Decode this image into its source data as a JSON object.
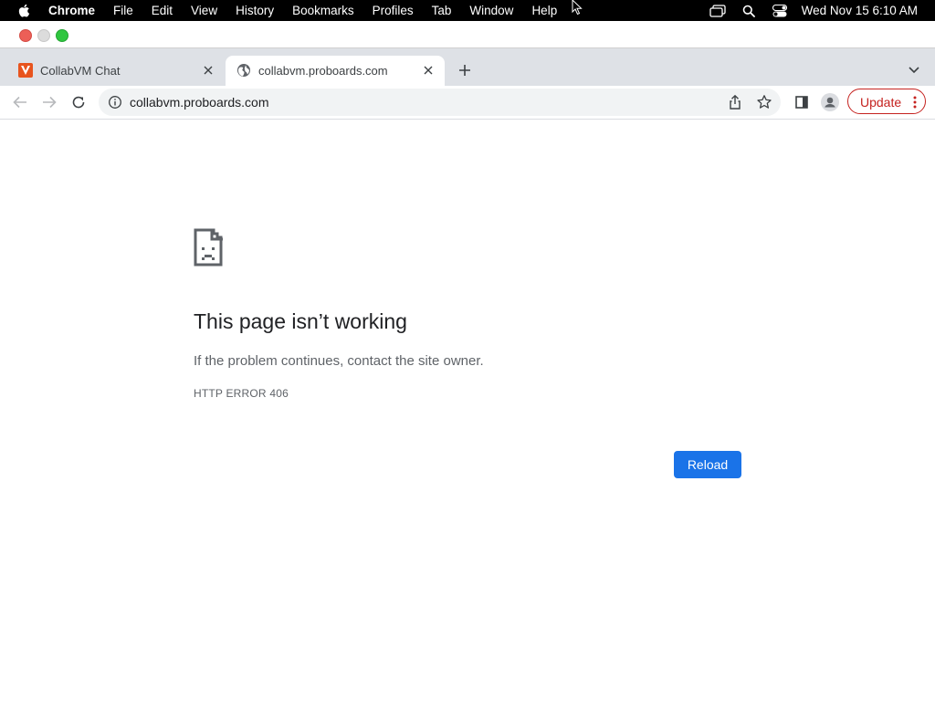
{
  "menubar": {
    "app_name": "Chrome",
    "items": [
      "File",
      "Edit",
      "View",
      "History",
      "Bookmarks",
      "Profiles",
      "Tab",
      "Window",
      "Help"
    ],
    "clock": "Wed Nov 15  6:10 AM",
    "icons": [
      "apple-icon",
      "screen-mirroring-icon",
      "spotlight-search-icon",
      "control-center-icon"
    ]
  },
  "tabs": [
    {
      "title": "CollabVM Chat",
      "favicon": "collabvm-favicon",
      "active": false
    },
    {
      "title": "collabvm.proboards.com",
      "favicon": "globe-icon",
      "active": true
    }
  ],
  "toolbar": {
    "url": "collabvm.proboards.com",
    "update_label": "Update"
  },
  "error_page": {
    "title": "This page isn’t working",
    "message": "If the problem continues, contact the site owner.",
    "code": "HTTP ERROR 406",
    "reload_label": "Reload"
  },
  "colors": {
    "accent_blue": "#1a73e8",
    "update_red": "#c5221f",
    "collabvm_orange": "#e8541e"
  }
}
